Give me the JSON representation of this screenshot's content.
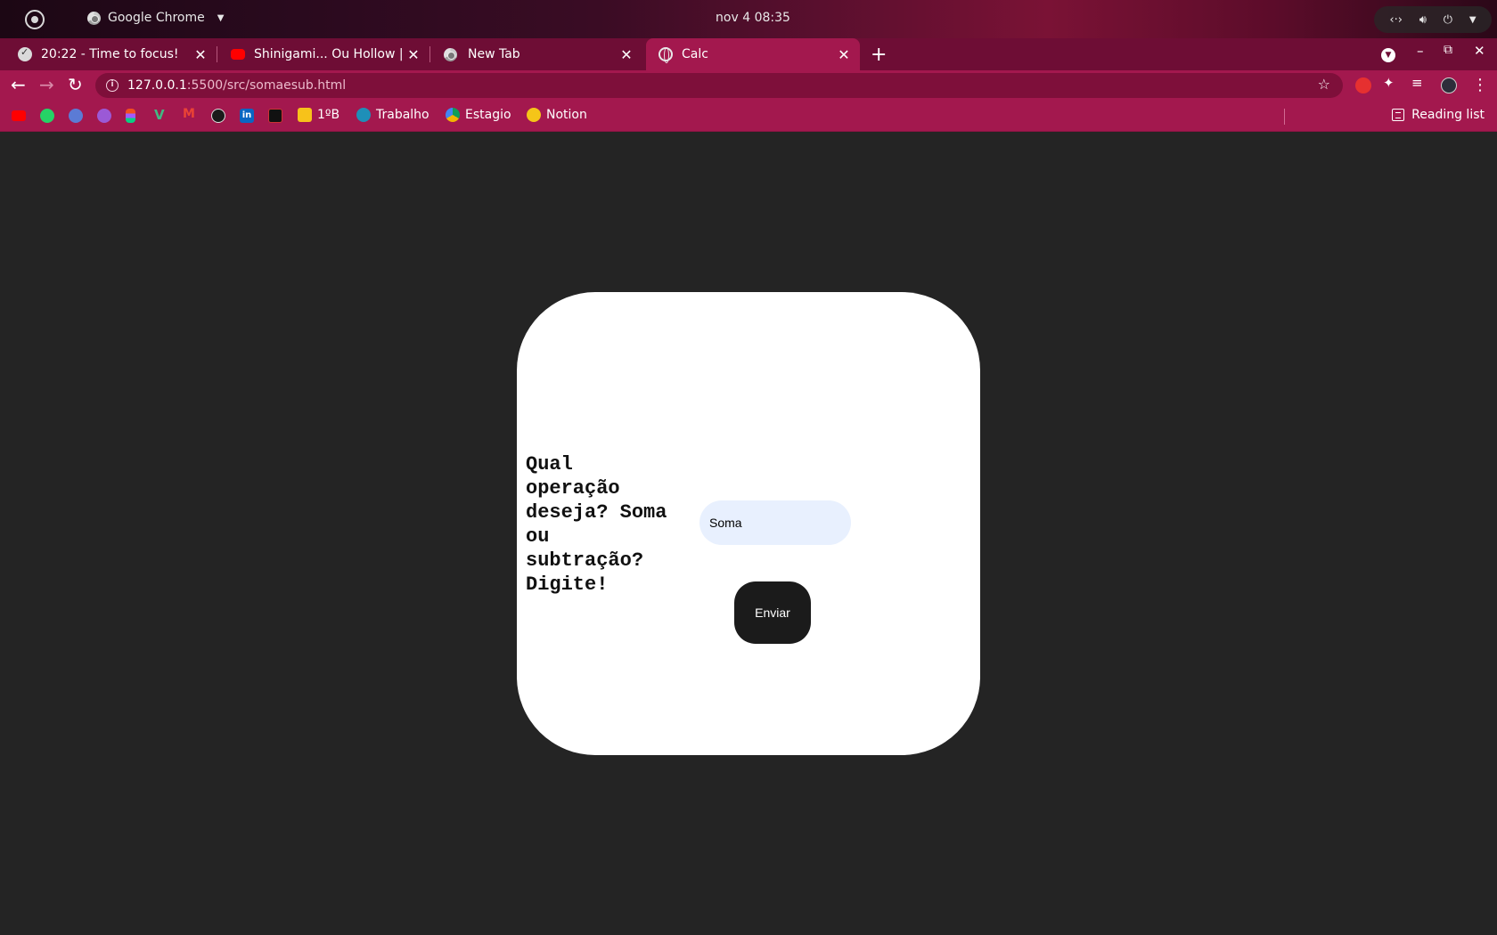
{
  "topbar": {
    "app_name": "Google Chrome",
    "clock": "nov 4  08:35"
  },
  "tabs": [
    {
      "title": "20:22 - Time to focus!",
      "icon": "check-circle-icon"
    },
    {
      "title": "Shinigami... Ou Hollow | Ic",
      "icon": "youtube-icon"
    },
    {
      "title": "New Tab",
      "icon": "chrome-icon"
    },
    {
      "title": "Calc",
      "icon": "globe-icon",
      "active": true
    }
  ],
  "address_bar": {
    "host": "127.0.0.1",
    "path": ":5500/src/somaesub.html"
  },
  "bookmarks": {
    "items": [
      {
        "label": "1ºB"
      },
      {
        "label": "Trabalho"
      },
      {
        "label": "Estagio"
      },
      {
        "label": "Notion"
      }
    ],
    "reading_list": "Reading list"
  },
  "page": {
    "question": "Qual operação deseja? Soma ou subtração? Digite!",
    "input_value": "Soma",
    "submit_label": "Enviar"
  },
  "colors": {
    "tab_strip": "#6e0d35",
    "toolbar": "#a3184e",
    "page_background": "#242424",
    "card": "#ffffff",
    "input_background": "#e8f0fe",
    "button": "#1b1b1b"
  }
}
